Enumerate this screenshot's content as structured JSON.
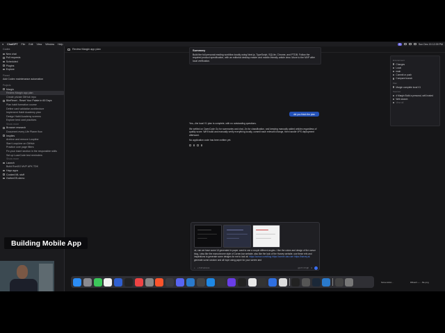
{
  "menubar": {
    "app": "ChatGPT",
    "items": [
      "File",
      "Edit",
      "View",
      "Window",
      "Help"
    ],
    "badge": "5",
    "clock": "Sun Dec 15 12:39 PM"
  },
  "sidebar": {
    "top": "Codex",
    "nav": [
      "New chat",
      "Pull requests",
      "Scheduled",
      "Plugins",
      "Explore"
    ],
    "pinned_title": "Pinned",
    "pinned": [
      "Add Codex maintenance automation"
    ],
    "projects_title": "Projects",
    "projects": [
      {
        "name": "Margin",
        "threads": [
          "Review Margin app plan",
          "Create private GitHub repo"
        ]
      },
      {
        "name": "BiteReset - Reset Your Palate in 60 Days",
        "threads": [
          "Plan habit formation course",
          "Define card validation architecture",
          "Implement Habit Academy plan",
          "Design Habit Academy screens",
          "Explore best card practices"
        ],
        "more": "Show more"
      },
      {
        "name": "Browser research",
        "threads": [
          "Document every Life Planer flow"
        ]
      },
      {
        "name": "Inspiles",
        "threads": [
          "Archive and remove Loopline",
          "Start LoopLine on GitHub",
          "Practice core page filters",
          "Fix your insert section in the responsible skills",
          "Set up LoanCode test reminders"
        ],
        "more": "Show more"
      },
      {
        "name": "Launch",
        "threads": [
          "Build RunGO MVP APK TDK"
        ]
      },
      {
        "name": "Hayo apps",
        "threads": []
      },
      {
        "name": "Cooked ML stuff",
        "threads": []
      },
      {
        "name": "GatherOS-demo",
        "threads": []
      }
    ]
  },
  "header": {
    "title": "Review Margin app plan"
  },
  "summary": {
    "title": "Summary",
    "text": "Build the full personal reading workflow locally using Next.js, TypeScript, SQLite, Chrome, and PTDB. Follow the required product specification, with an editorial desktop reader and mobile-friendly article view. Move to the MVP after local verification."
  },
  "user_message": "did you finish the plan",
  "reply": {
    "p1": "Yes—the local V1 plan is complete, with no outstanding questions.",
    "p2": "We settled on OpenCode Go for summaries and chat, Jin for classification, and keeping manually added articles regardless of quality score. We'll build and manually verify everything locally, commit each relevant change, then handle VPS deployment afterward.",
    "p3": "No application code has been written yet."
  },
  "right_panel": {
    "environment_title": "Environment",
    "environment": [
      "Changes",
      "Local",
      "main",
      "Commit or push",
      "Compare branch"
    ],
    "plan_title": "Plan",
    "plan": [
      "Margin complete local V1"
    ],
    "sources_title": "Sources",
    "sources": [
      "# Margin Build a personal, self-hosted",
      "Web search",
      "View all"
    ]
  },
  "composer": {
    "text_a": "ok, can we have some UI generated in paper. want to use a couple different angles. i like the colors and design of the cursor blog, i also like the monochrome style of Corner-bar website. also like the look of the Harvey website. use these refs and inspirations to generate some designs for me to look at: ",
    "link": "https://cursor.com/blog https://corner-bar.com https://harvey.ai",
    "text_b": ". generate some random and all hope using paper for your screen and",
    "foot_left": "+ Full access",
    "foot_right": "gpt-5.4 high"
  },
  "overlay": {
    "caption": "Building Mobile App"
  },
  "desktop": {
    "file1": "Screenshot...",
    "file2": "DRaw3 — ...file.png"
  },
  "colors": {
    "accent": "#3a6df0",
    "user_bubble": "#2452b8",
    "link": "#5a8cf0"
  }
}
